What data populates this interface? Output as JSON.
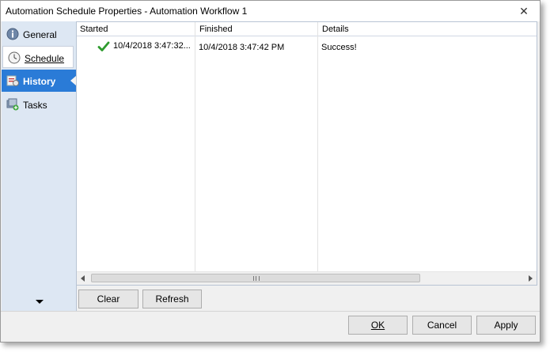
{
  "window": {
    "title": "Automation Schedule Properties - Automation Workflow 1",
    "close_glyph": "✕"
  },
  "sidebar": {
    "items": [
      {
        "label": "General",
        "icon": "info-icon"
      },
      {
        "label": "Schedule",
        "icon": "clock-icon"
      },
      {
        "label": "History",
        "icon": "history-icon",
        "active": true
      },
      {
        "label": "Tasks",
        "icon": "tasks-icon"
      }
    ]
  },
  "history": {
    "columns": [
      "Started",
      "Finished",
      "Details"
    ],
    "rows": [
      {
        "status_icon": "success-check-icon",
        "started": "10/4/2018 3:47:32...",
        "finished": "10/4/2018 3:47:42 PM",
        "details": "Success!"
      }
    ]
  },
  "buttons": {
    "clear": "Clear",
    "refresh": "Refresh",
    "ok": "OK",
    "cancel": "Cancel",
    "apply": "Apply"
  },
  "colors": {
    "accent": "#2a7bd7",
    "sidebar_bg": "#dde7f3",
    "success": "#2e9b2e"
  }
}
